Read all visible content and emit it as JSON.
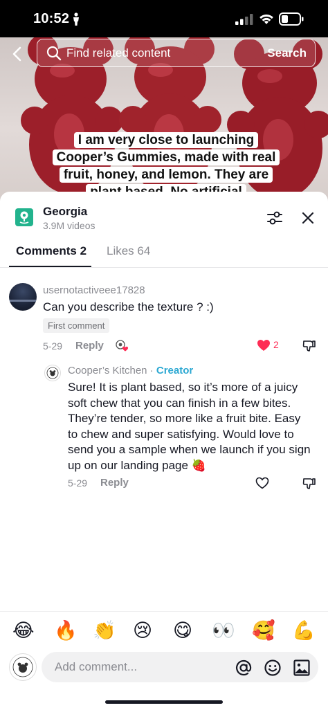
{
  "status_bar": {
    "time": "10:52"
  },
  "search": {
    "placeholder": "Find related content",
    "button_label": "Search"
  },
  "video": {
    "caption": "I am very close to launching Cooper’s Gummies, made with real fruit, honey, and lemon. They are plant based. No artificial"
  },
  "location": {
    "title": "Georgia",
    "subtitle": "3.9M videos",
    "icon": "location-pin-icon"
  },
  "tabs": [
    {
      "label": "Comments 2",
      "active": true
    },
    {
      "label": "Likes 64",
      "active": false
    }
  ],
  "comments": [
    {
      "username": "usernotactiveee17828",
      "text": "Can you describe the texture ? :)",
      "badge": "First comment",
      "date": "5-29",
      "reply_label": "Reply",
      "like_count": "2",
      "replies": [
        {
          "username": "Cooper’s Kitchen",
          "separator": " · ",
          "tag": "Creator",
          "text": "Sure! It is plant based, so it’s more of a juicy soft chew that you can finish in a few bites. They’re tender, so more like a fruit bite. Easy to chew and super satisfying. Would love to send you a sample when we launch if you sign up on our landing page 🍓",
          "date": "5-29",
          "reply_label": "Reply"
        }
      ]
    }
  ],
  "emoji_bar": [
    "😂",
    "🔥",
    "👏",
    "😢",
    "😋",
    "👀",
    "🥰",
    "💪"
  ],
  "comment_input": {
    "placeholder": "Add comment..."
  },
  "colors": {
    "accent_red": "#fe2c55",
    "creator_blue": "#2ca8d2",
    "location_green": "#22b38d"
  }
}
